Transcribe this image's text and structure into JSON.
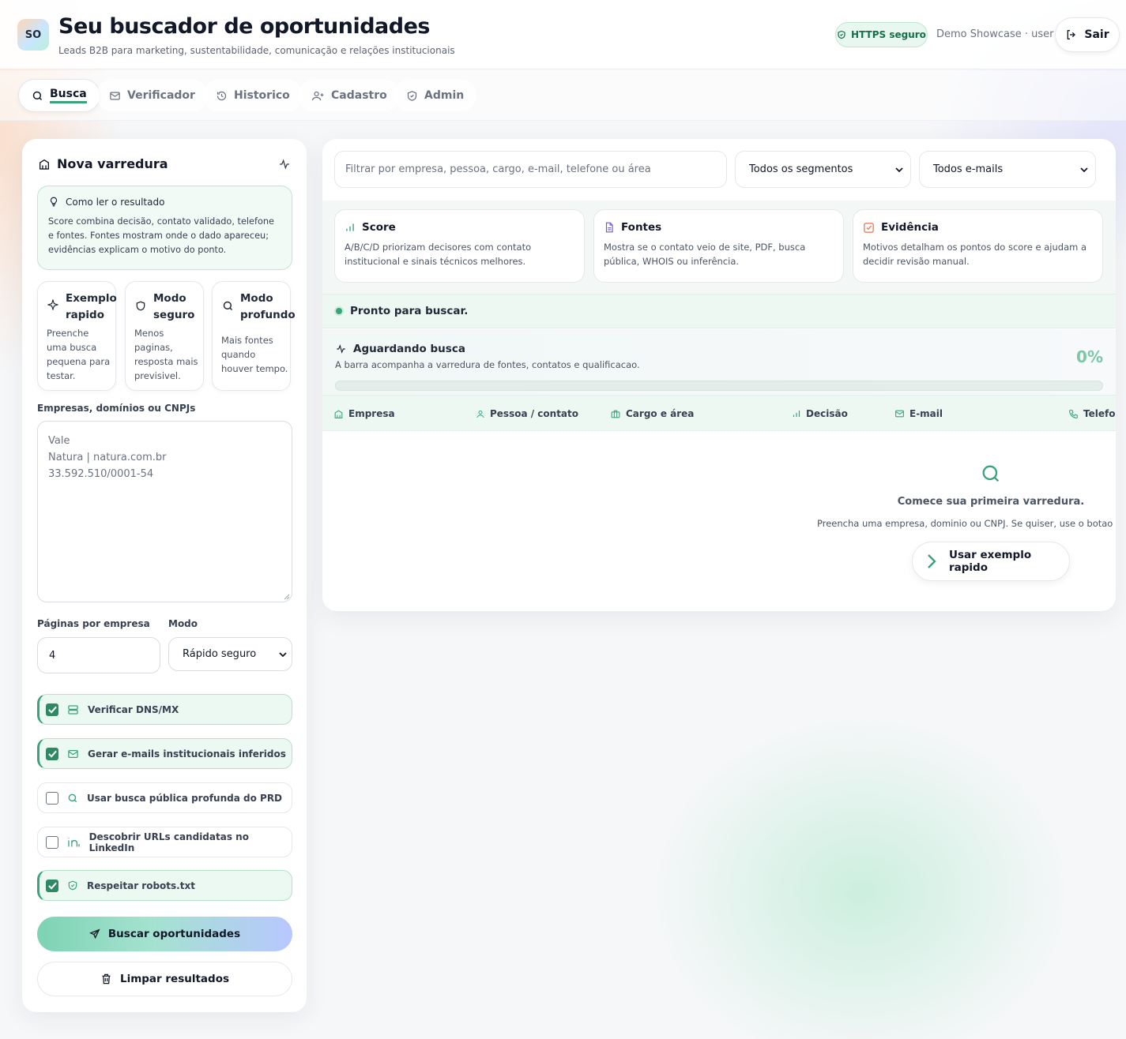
{
  "header": {
    "logo_text": "SO",
    "title": "Seu buscador de oportunidades",
    "subtitle": "Leads B2B para marketing, sustentabilidade, comunicação e relações institucionais",
    "https_badge": "HTTPS seguro",
    "user_info": "Demo Showcase · user",
    "logout_label": "Sair"
  },
  "nav": {
    "tabs": [
      {
        "label": "Busca",
        "icon": "search-icon",
        "active": true
      },
      {
        "label": "Verificador",
        "icon": "mail-icon",
        "active": false
      },
      {
        "label": "Historico",
        "icon": "history-icon",
        "active": false
      },
      {
        "label": "Cadastro",
        "icon": "user-plus-icon",
        "active": false
      },
      {
        "label": "Admin",
        "icon": "shield-check-icon",
        "active": false
      }
    ]
  },
  "left_panel": {
    "title": "Nova varredura",
    "info": {
      "title": "Como ler o resultado",
      "body": "Score combina decisão, contato validado, telefone e fontes. Fontes mostram onde o dado apareceu; evidências explicam o motivo do ponto."
    },
    "modes": [
      {
        "title": "Exemplo rapido",
        "desc": "Preenche uma busca pequena para testar.",
        "icon": "sparkle-icon"
      },
      {
        "title": "Modo seguro",
        "desc": "Menos paginas, resposta mais previsivel.",
        "icon": "shield-icon"
      },
      {
        "title": "Modo profundo",
        "desc": "Mais fontes quando houver tempo.",
        "icon": "search-icon"
      }
    ],
    "companies_label": "Empresas, domínios ou CNPJs",
    "companies_placeholder": "Vale\nNatura | natura.com.br\n33.592.510/0001-54",
    "pages_label": "Páginas por empresa",
    "pages_value": "4",
    "mode_label": "Modo",
    "mode_value": "Rápido seguro",
    "options": [
      {
        "label": "Verificar DNS/MX",
        "checked": true,
        "icon": "server-icon"
      },
      {
        "label": "Gerar e-mails institucionais inferidos",
        "checked": true,
        "icon": "mail-icon"
      },
      {
        "label": "Usar busca pública profunda do PRD",
        "checked": false,
        "icon": "search-icon"
      },
      {
        "label": "Descobrir URLs candidatas no LinkedIn",
        "checked": false,
        "icon": "linkedin-icon"
      },
      {
        "label": "Respeitar robots.txt",
        "checked": true,
        "icon": "shield-check-icon"
      }
    ],
    "search_button": "Buscar oportunidades",
    "clear_button": "Limpar resultados"
  },
  "right_panel": {
    "filter_placeholder": "Filtrar por empresa, pessoa, cargo, e-mail, telefone ou área",
    "segment_select": "Todos os segmentos",
    "email_select": "Todos e-mails",
    "legend": [
      {
        "title": "Score",
        "desc": "A/B/C/D priorizam decisores com contato institucional e sinais técnicos melhores.",
        "icon": "bar-chart-icon",
        "color": "#3aa37c"
      },
      {
        "title": "Fontes",
        "desc": "Mostra se o contato veio de site, PDF, busca pública, WHOIS ou inferência.",
        "icon": "file-icon",
        "color": "#6d5bd0"
      },
      {
        "title": "Evidência",
        "desc": "Motivos detalham os pontos do score e ajudam a decidir revisão manual.",
        "icon": "check-square-icon",
        "color": "#e0734a"
      }
    ],
    "status": "Pronto para buscar.",
    "progress": {
      "title": "Aguardando busca",
      "desc": "A barra acompanha a varredura de fontes, contatos e qualificacao.",
      "percent_label": "0%",
      "fraction": 0
    },
    "table_headers": [
      {
        "label": "Empresa",
        "icon": "building-icon"
      },
      {
        "label": "Pessoa / contato",
        "icon": "user-icon"
      },
      {
        "label": "Cargo e área",
        "icon": "briefcase-icon"
      },
      {
        "label": "Decisão",
        "icon": "bar-chart-icon"
      },
      {
        "label": "E-mail",
        "icon": "mail-icon"
      },
      {
        "label": "Telefon",
        "icon": "phone-icon"
      }
    ],
    "empty_state": {
      "title": "Comece sua primeira varredura.",
      "desc": "Preencha uma empresa, dominio ou CNPJ. Se quiser, use o botao Exem",
      "button": "Usar exemplo rapido"
    }
  },
  "colors": {
    "accent": "#3aa37c",
    "accent_light": "#ecf8f2",
    "text": "#111827"
  }
}
